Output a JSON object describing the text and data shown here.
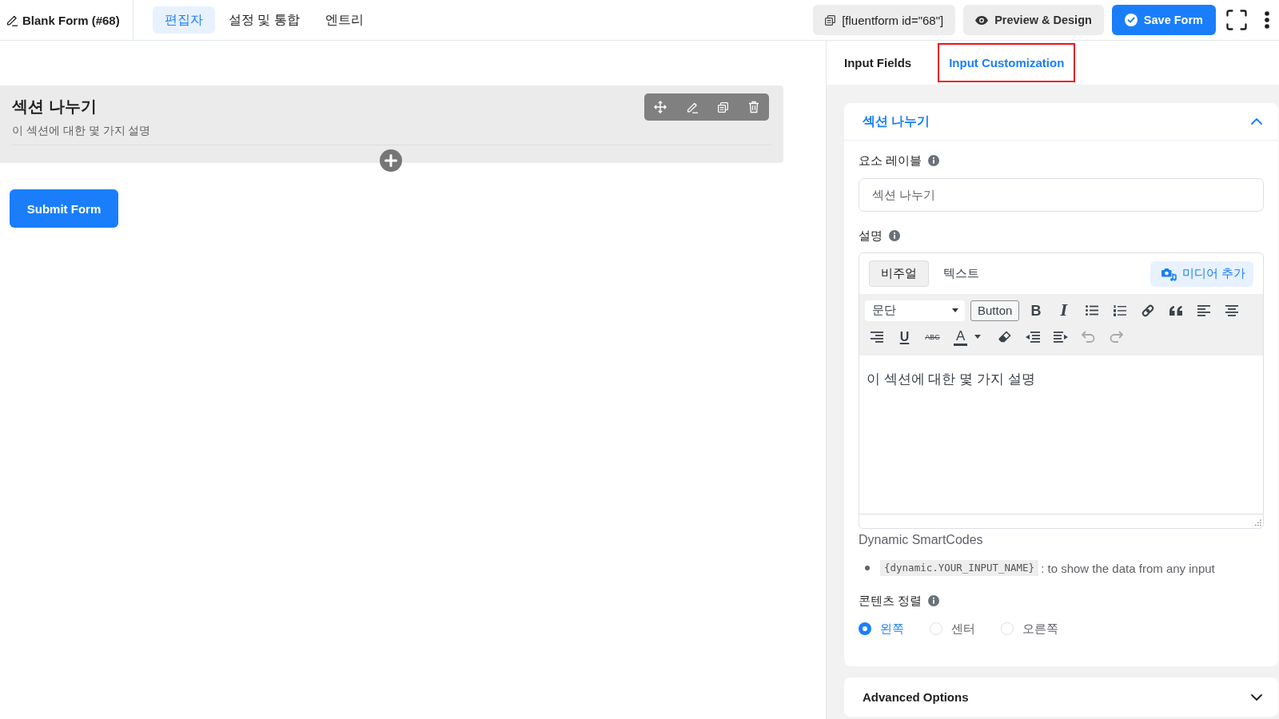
{
  "header": {
    "form_title": "Blank Form (#68)",
    "tabs": [
      {
        "label": "편집자",
        "selected": true
      },
      {
        "label": "설정 및 통합",
        "selected": false
      },
      {
        "label": "엔트리",
        "selected": false
      }
    ],
    "shortcode": "[fluentform id=\"68\"]",
    "preview_button": "Preview & Design",
    "save_button": "Save Form"
  },
  "canvas": {
    "section": {
      "title": "섹션 나누기",
      "description": "이 섹션에 대한 몇 가지 설명"
    },
    "submit_button": "Submit Form"
  },
  "sidebar": {
    "tabs": [
      {
        "label": "Input Fields",
        "selected": false,
        "highlighted": false
      },
      {
        "label": "Input Customization",
        "selected": true,
        "highlighted": true
      }
    ],
    "panel": {
      "title": "섹션 나누기",
      "expanded": true,
      "element_label": {
        "label": "요소 레이블",
        "value": "섹션 나누기"
      },
      "description": {
        "label": "설명",
        "modes": [
          {
            "label": "비주얼",
            "selected": true
          },
          {
            "label": "텍스트",
            "selected": false
          }
        ],
        "media_button": "미디어 추가",
        "toolbar": [
          {
            "kind": "format",
            "value": "문단",
            "disabled": false
          },
          {
            "kind": "text_button",
            "label": "Button",
            "disabled": false
          },
          {
            "kind": "bold",
            "glyph": "B",
            "disabled": false
          },
          {
            "kind": "italic",
            "glyph": "I",
            "disabled": false
          },
          {
            "kind": "bullet_list",
            "disabled": false
          },
          {
            "kind": "numbered_list",
            "disabled": false
          },
          {
            "kind": "link",
            "disabled": false
          },
          {
            "kind": "blockquote",
            "disabled": false
          },
          {
            "kind": "align_left",
            "disabled": false
          },
          {
            "kind": "align_center",
            "disabled": false
          },
          {
            "kind": "align_right",
            "disabled": false
          },
          {
            "kind": "underline",
            "glyph": "U",
            "disabled": false
          },
          {
            "kind": "strikethrough",
            "glyph": "ABC",
            "disabled": false
          },
          {
            "kind": "text_color",
            "glyph": "A",
            "disabled": false
          },
          {
            "kind": "clear_formatting",
            "disabled": false
          },
          {
            "kind": "outdent",
            "disabled": false
          },
          {
            "kind": "indent",
            "disabled": false
          },
          {
            "kind": "undo",
            "disabled": true
          },
          {
            "kind": "redo",
            "disabled": true
          }
        ],
        "content": "이 섹션에 대한 몇 가지 설명"
      },
      "smartcodes": {
        "title": "Dynamic SmartCodes",
        "items": [
          {
            "code": "{dynamic.YOUR_INPUT_NAME}",
            "text": ": to show the data from any input"
          }
        ]
      },
      "alignment": {
        "label": "콘텐츠 정렬",
        "options": [
          {
            "label": "왼쪽",
            "selected": true
          },
          {
            "label": "센터",
            "selected": false
          },
          {
            "label": "오른쪽",
            "selected": false
          }
        ]
      }
    },
    "advanced": {
      "title": "Advanced Options",
      "expanded": false
    }
  }
}
